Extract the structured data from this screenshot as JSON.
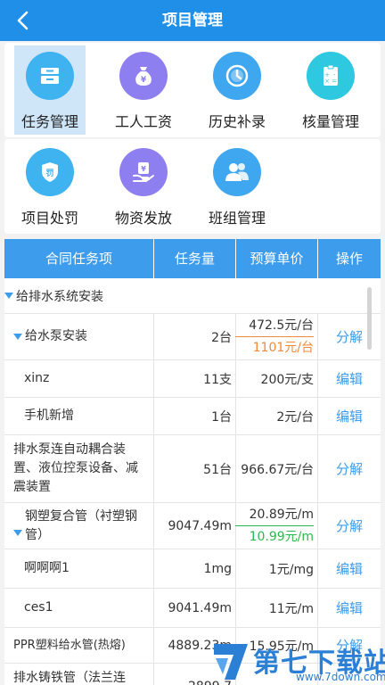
{
  "header": {
    "title": "项目管理"
  },
  "menu": {
    "row1": [
      {
        "label": "任务管理",
        "icon": "archive-box-icon",
        "color": "#3fb3f0",
        "active": true
      },
      {
        "label": "工人工资",
        "icon": "money-bag-icon",
        "color": "#8e7ff0"
      },
      {
        "label": "历史补录",
        "icon": "clock-icon",
        "color": "#3fa6f0"
      },
      {
        "label": "核量管理",
        "icon": "clipboard-calculator-icon",
        "color": "#2ec8e0"
      }
    ],
    "row2": [
      {
        "label": "项目处罚",
        "icon": "shield-penalty-icon",
        "color": "#3fb3f0"
      },
      {
        "label": "物资发放",
        "icon": "hand-coin-icon",
        "color": "#8e7ff0"
      },
      {
        "label": "班组管理",
        "icon": "group-people-icon",
        "color": "#3fa6f0"
      }
    ]
  },
  "table": {
    "headers": {
      "name": "合同任务项",
      "qty": "任务量",
      "price": "预算单价",
      "op": "操作"
    },
    "group1": "给排水系统安装",
    "rows": [
      {
        "name": "给水泵安装",
        "qty": "2台",
        "price": "472.5元/台",
        "price2": "1101元/台",
        "op": "分解"
      },
      {
        "name": "xinz",
        "qty": "11支",
        "price": "200元/支",
        "op": "编辑"
      },
      {
        "name": "手机新增",
        "qty": "1台",
        "price": "2元/台",
        "op": "编辑"
      },
      {
        "name": "排水泵连自动耦合装置、液位控泵设备、减震装置",
        "qty": "51台",
        "price": "966.67元/台",
        "op": "分解"
      },
      {
        "name": "钢塑复合管（衬塑钢管）",
        "qty": "9047.49m",
        "price": "20.89元/m",
        "price2": "10.99元/m",
        "op": "分解"
      },
      {
        "name": "啊啊啊1",
        "qty": "1mg",
        "price": "1元/mg",
        "op": "编辑"
      },
      {
        "name": "ces1",
        "qty": "9041.49m",
        "price": "11元/m",
        "op": "编辑"
      },
      {
        "name": "PPR塑料给水管(热熔)",
        "qty": "4889.23m",
        "price": "15.95元/m",
        "op": "分解"
      },
      {
        "name": "排水铸铁管（法兰连",
        "qty": "2899.7",
        "price": "",
        "op": ""
      }
    ]
  },
  "watermark": {
    "text": "第七下载站",
    "sub": "www.7down.com"
  }
}
